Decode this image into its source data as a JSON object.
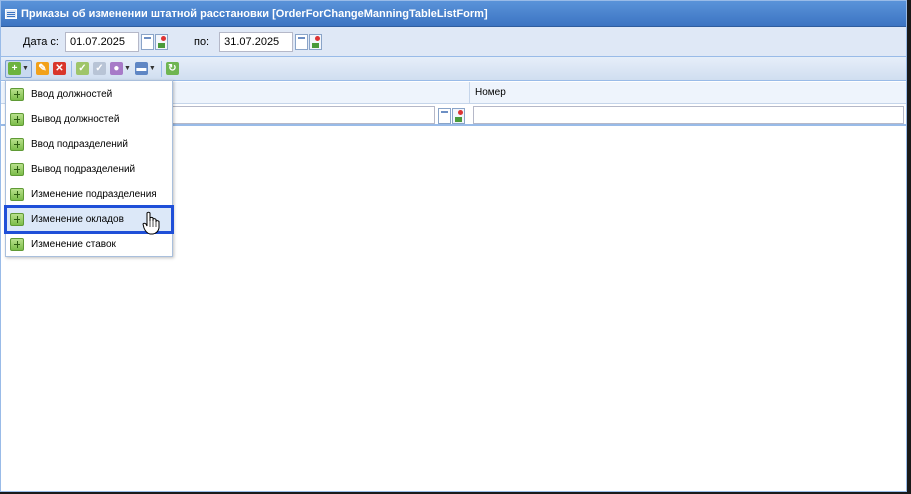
{
  "window": {
    "title": "Приказы об изменении штатной расстановки [OrderForChangeManningTableListForm]"
  },
  "filters": {
    "date_from_label": "Дата с:",
    "date_from_value": "01.07.2025",
    "date_to_label": "по:",
    "date_to_value": "31.07.2025"
  },
  "toolbar": {
    "icons": [
      "add-icon",
      "edit-icon",
      "delete-icon",
      "approve-icon",
      "unapprove-icon",
      "settings-icon",
      "print-icon",
      "refresh-icon"
    ],
    "colors": {
      "add": "#6db33f",
      "edit": "#f2a11a",
      "delete": "#d9362b"
    }
  },
  "grid": {
    "columns": [
      "",
      "Номер"
    ]
  },
  "add_menu": {
    "items": [
      "Ввод должностей",
      "Вывод должностей",
      "Ввод подразделений",
      "Вывод подразделений",
      "Изменение подразделения",
      "Изменение окладов",
      "Изменение ставок"
    ],
    "highlighted_index": 5
  }
}
